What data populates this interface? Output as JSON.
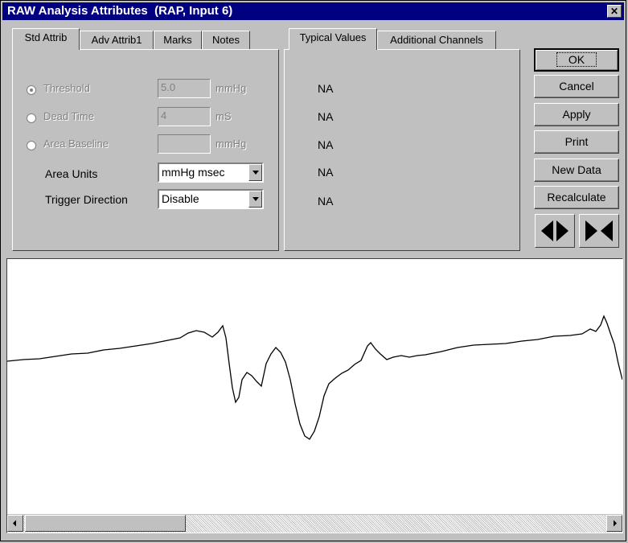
{
  "window": {
    "title": "RAW Analysis Attributes  (RAP, Input 6)",
    "close_glyph": "✕"
  },
  "left_tabs": [
    "Std Attrib",
    "Adv Attrib1",
    "Marks",
    "Notes"
  ],
  "std_attrib": {
    "threshold": {
      "label": "Threshold",
      "value": "5.0",
      "unit": "mmHg",
      "selected": true
    },
    "dead_time": {
      "label": "Dead Time",
      "value": "4",
      "unit": "mS",
      "selected": false
    },
    "area_baseline": {
      "label": "Area Baseline",
      "value": "",
      "unit": "mmHg",
      "selected": false
    },
    "area_units": {
      "label": "Area Units",
      "value": "mmHg msec"
    },
    "trigger_direction": {
      "label": "Trigger Direction",
      "value": "Disable"
    }
  },
  "right_tabs": [
    "Typical Values",
    "Additional Channels"
  ],
  "typical_values": [
    "NA",
    "NA",
    "NA",
    "NA",
    "NA"
  ],
  "buttons": {
    "ok": "OK",
    "cancel": "Cancel",
    "apply": "Apply",
    "print": "Print",
    "new_data": "New Data",
    "recalculate": "Recalculate"
  },
  "icons": {
    "expand": "expand-arrows-icon",
    "contract": "contract-arrows-icon"
  }
}
